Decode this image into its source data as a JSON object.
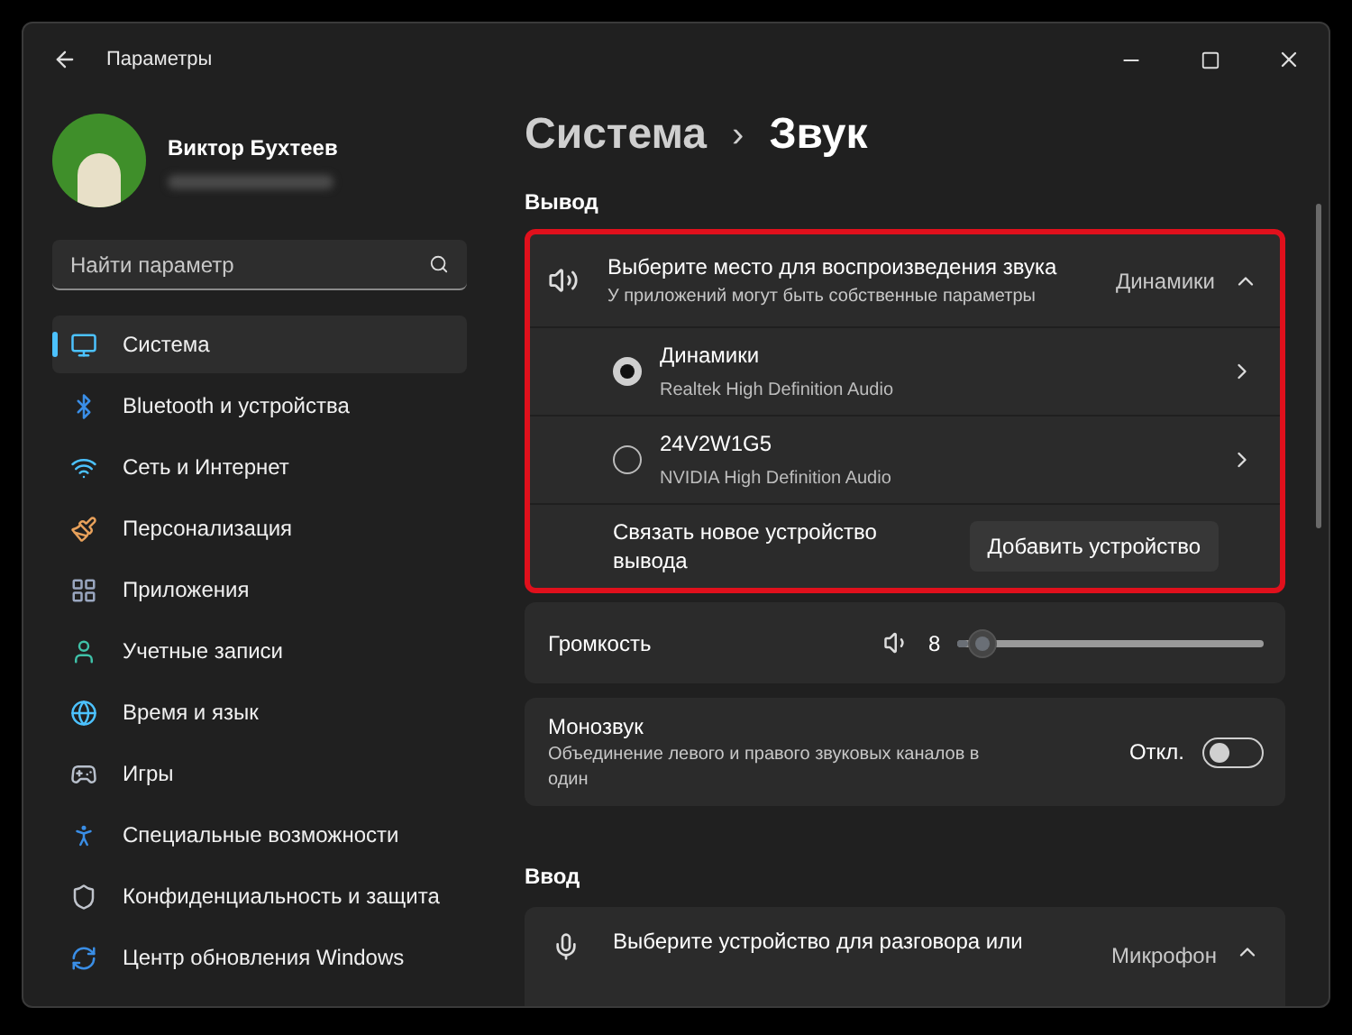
{
  "window": {
    "title": "Параметры"
  },
  "user": {
    "name": "Виктор Бухтеев"
  },
  "search": {
    "placeholder": "Найти параметр"
  },
  "sidebar": {
    "items": [
      {
        "label": "Система",
        "selected": true
      },
      {
        "label": "Bluetooth и устройства",
        "selected": false
      },
      {
        "label": "Сеть и Интернет",
        "selected": false
      },
      {
        "label": "Персонализация",
        "selected": false
      },
      {
        "label": "Приложения",
        "selected": false
      },
      {
        "label": "Учетные записи",
        "selected": false
      },
      {
        "label": "Время и язык",
        "selected": false
      },
      {
        "label": "Игры",
        "selected": false
      },
      {
        "label": "Специальные возможности",
        "selected": false
      },
      {
        "label": "Конфиденциальность и защита",
        "selected": false
      },
      {
        "label": "Центр обновления Windows",
        "selected": false
      }
    ]
  },
  "breadcrumb": {
    "parent": "Система",
    "separator": "›",
    "current": "Звук"
  },
  "output": {
    "heading": "Вывод",
    "highlighted": true,
    "selector": {
      "title": "Выберите место для воспроизведения звука",
      "subtitle": "У приложений могут быть собственные параметры",
      "value": "Динамики",
      "expanded": true
    },
    "devices": [
      {
        "name": "Динамики",
        "driver": "Realtek High Definition Audio",
        "selected": true
      },
      {
        "name": "24V2W1G5",
        "driver": "NVIDIA High Definition Audio",
        "selected": false
      }
    ],
    "pair": {
      "label": "Связать новое устройство вывода",
      "button": "Добавить устройство"
    }
  },
  "volume": {
    "label": "Громкость",
    "reading": "8",
    "level": 0.08
  },
  "mono": {
    "title": "Монозвук",
    "description": "Объединение левого и правого звуковых каналов в один",
    "state_label": "Откл.",
    "on": false
  },
  "input": {
    "heading": "Ввод",
    "selector": {
      "title": "Выберите устройство для разговора или",
      "value": "Микрофон"
    }
  }
}
